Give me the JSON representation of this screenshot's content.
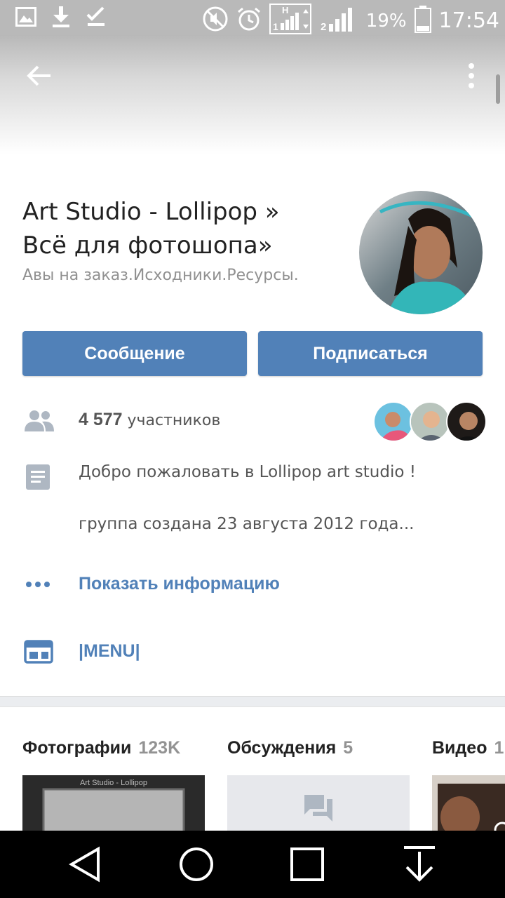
{
  "status_bar": {
    "battery": "19%",
    "time": "17:54",
    "sim1_label": "H",
    "sim1_num": "1",
    "sim2_num": "2",
    "icons": [
      "gallery-icon",
      "download-icon",
      "check-icon",
      "mute-icon",
      "alarm-icon",
      "signal-icon",
      "battery-icon"
    ]
  },
  "toolbar": {
    "back_icon": "arrow-left-icon",
    "more_icon": "more-vertical-icon"
  },
  "group": {
    "name_line1": "Art Studio - Lollipop  »",
    "name_line2": "Всё для фотошопа»",
    "status": "Авы на заказ.Исходники.Ресурсы."
  },
  "buttons": {
    "message": "Сообщение",
    "subscribe": "Подписаться"
  },
  "members": {
    "count": "4 577",
    "label": "участников"
  },
  "description": {
    "line1": "Добро пожаловать  в Lollipop art studio !",
    "line2": "группа создана 23 августа 2012 года..."
  },
  "links": {
    "show_info": "Показать информацию",
    "menu": "|MENU|"
  },
  "sections": [
    {
      "title": "Фотографии",
      "count": "123K"
    },
    {
      "title": "Обсуждения",
      "count": "5"
    },
    {
      "title": "Видео",
      "count": "1"
    }
  ],
  "photo_thumb_caption": "Art Studio - Lollipop",
  "colors": {
    "accent": "#5181b8",
    "icon_gray": "#aeb7c2",
    "status_bar": "#b9b9b9"
  }
}
